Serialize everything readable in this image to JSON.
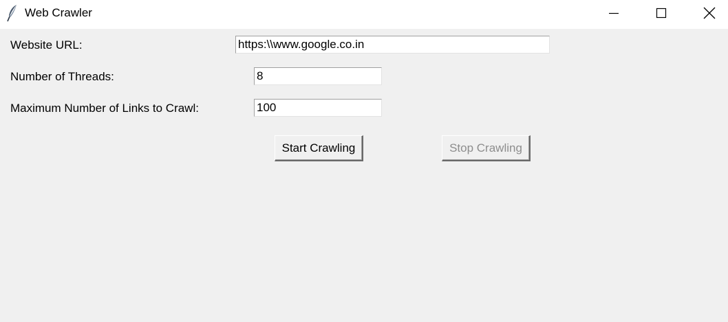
{
  "window": {
    "title": "Web Crawler",
    "icon": "feather-icon",
    "controls": {
      "minimize_icon": "minimize-icon",
      "maximize_icon": "maximize-icon",
      "close_icon": "close-icon"
    }
  },
  "form": {
    "url": {
      "label": "Website URL:",
      "value": "https:\\\\www.google.co.in"
    },
    "threads": {
      "label": "Number of Threads:",
      "value": "8"
    },
    "max_links": {
      "label": "Maximum Number of Links to Crawl:",
      "value": "100"
    }
  },
  "actions": {
    "start_label": "Start Crawling",
    "stop_label": "Stop Crawling",
    "stop_disabled": true
  }
}
